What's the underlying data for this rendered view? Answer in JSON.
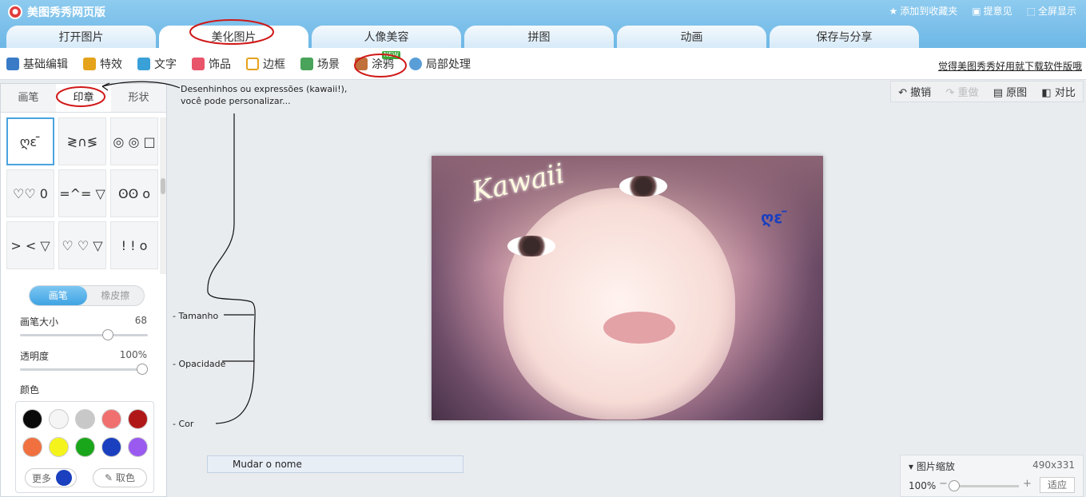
{
  "app": {
    "title": "美图秀秀网页版"
  },
  "top_links": {
    "favorite": "添加到收藏夹",
    "feedback": "提意见",
    "fullscreen": "全屏显示"
  },
  "tabs": [
    {
      "label": "打开图片"
    },
    {
      "label": "美化图片"
    },
    {
      "label": "人像美容"
    },
    {
      "label": "拼图"
    },
    {
      "label": "动画"
    },
    {
      "label": "保存与分享"
    }
  ],
  "toolbar": {
    "items": [
      {
        "label": "基础编辑",
        "color": "#3a7bc8"
      },
      {
        "label": "特效",
        "color": "#e4a31a"
      },
      {
        "label": "文字",
        "color": "#3aa0d8"
      },
      {
        "label": "饰品",
        "color": "#e8546a"
      },
      {
        "label": "边框",
        "color": "#e6a21c"
      },
      {
        "label": "场景",
        "color": "#4aa35a"
      },
      {
        "label": "涂鸦",
        "color": "#c0703a"
      },
      {
        "label": "局部处理",
        "color": "#5a9ed8"
      }
    ],
    "new_badge": "NEW",
    "download_link": "觉得美图秀秀好用就下载软件版哦"
  },
  "panel": {
    "subtabs": [
      {
        "label": "画笔"
      },
      {
        "label": "印章"
      },
      {
        "label": "形状"
      }
    ],
    "stamps": [
      "ღε ̄",
      "≷∩≶",
      "◎ ◎ □",
      "♡♡ 0",
      "=^= ▽",
      "ʘʘ o",
      "> < ▽",
      "♡ ♡ ▽",
      "!  !  o"
    ],
    "mode": {
      "brush": "画笔",
      "eraser": "橡皮擦"
    },
    "brush_size": {
      "label": "画笔大小",
      "value": "68",
      "fraction": 0.68
    },
    "opacity": {
      "label": "透明度",
      "value": "100%",
      "fraction": 1.0
    },
    "color_label": "颜色",
    "colors": [
      "#0a0a0a",
      "#f5f5f5",
      "#c8c8c8",
      "#f07070",
      "#b01818",
      "#f07040",
      "#f4f41c",
      "#1aa61a",
      "#1a3fbf",
      "#9a5af0"
    ],
    "more": "更多",
    "pick": "取色"
  },
  "annotations": {
    "kawaii_note": "Desenhinhos ou expressões (kawaii!),\nvocê pode personalizar...",
    "size": "- Tamanho",
    "opacity": "- Opacidade",
    "color": "- Cor"
  },
  "history": {
    "undo": "撤销",
    "redo": "重做",
    "original": "原图",
    "compare": "对比"
  },
  "photo": {
    "caption": "Kawaii",
    "stamp": "ღε ̄"
  },
  "rename": {
    "label": "Mudar o nome"
  },
  "zoom": {
    "title": "图片缩放",
    "size": "490x331",
    "percent": "100%",
    "fit": "适应"
  }
}
